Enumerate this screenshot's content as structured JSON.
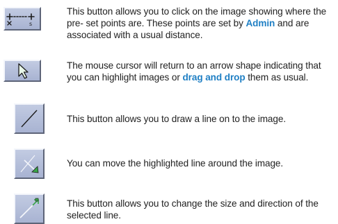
{
  "items": [
    {
      "icon": "preset-points-icon",
      "text_before": "This button allows you to click on the image showing where the pre- set points are. These points are set by ",
      "highlight": "Admin",
      "text_after": " and are associated with a usual distance."
    },
    {
      "icon": "arrow-cursor-icon",
      "text_before": "The mouse cursor will return to an arrow shape indicating that you can highlight images or ",
      "highlight": "drag and drop",
      "text_after": " them as usual."
    },
    {
      "icon": "draw-line-icon",
      "text": "This button allows you to draw a line on to the image."
    },
    {
      "icon": "move-line-icon",
      "text": "You can move the highlighted line around the image."
    },
    {
      "icon": "resize-line-icon",
      "text": "This button allows you to change the size and direction of the selected line."
    }
  ],
  "colors": {
    "highlight": "#1f7fc4",
    "button_face": "#b4bedb",
    "text": "#222222"
  }
}
